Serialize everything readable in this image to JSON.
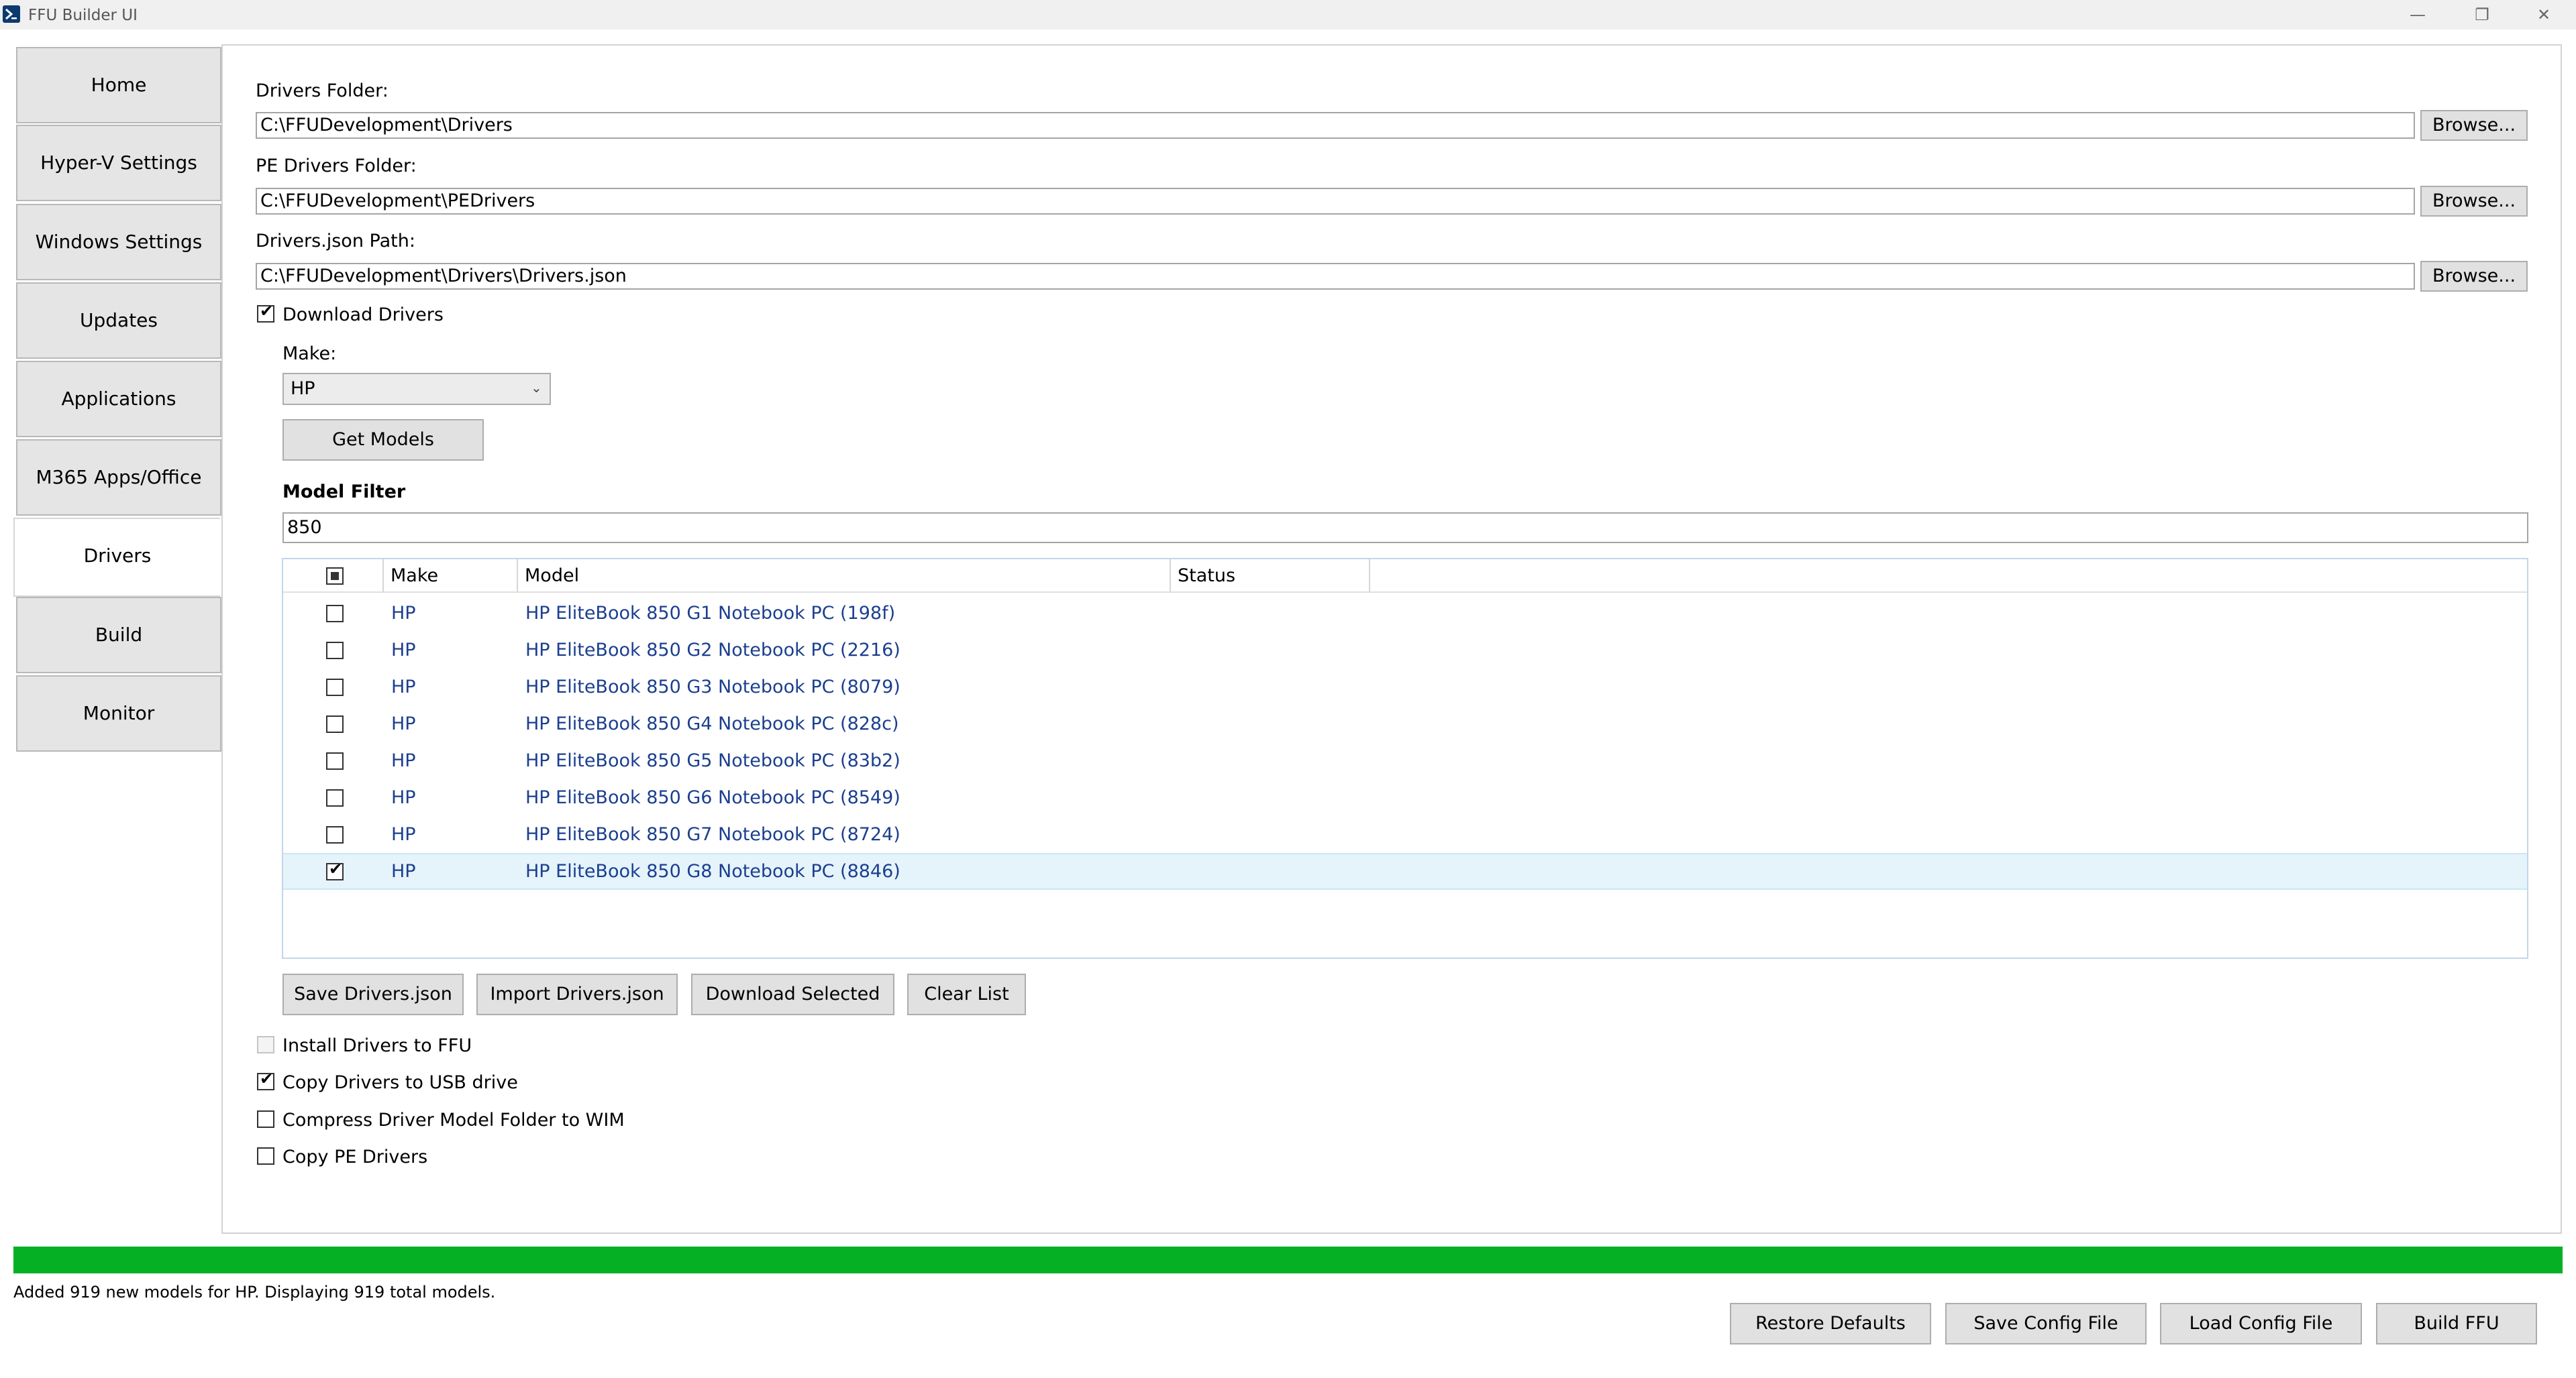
{
  "window": {
    "title": "FFU Builder UI",
    "minimize_glyph": "—",
    "restore_glyph": "❐",
    "close_glyph": "✕"
  },
  "nav": {
    "items": [
      {
        "label": "Home"
      },
      {
        "label": "Hyper-V Settings"
      },
      {
        "label": "Windows Settings"
      },
      {
        "label": "Updates"
      },
      {
        "label": "Applications"
      },
      {
        "label": "M365 Apps/Office"
      },
      {
        "label": "Drivers"
      },
      {
        "label": "Build"
      },
      {
        "label": "Monitor"
      }
    ],
    "active": "Drivers"
  },
  "drivers": {
    "drivers_folder_label": "Drivers Folder:",
    "drivers_folder_value": "C:\\FFUDevelopment\\Drivers",
    "pe_drivers_folder_label": "PE Drivers Folder:",
    "pe_drivers_folder_value": "C:\\FFUDevelopment\\PEDrivers",
    "drivers_json_label": "Drivers.json Path:",
    "drivers_json_value": "C:\\FFUDevelopment\\Drivers\\Drivers.json",
    "browse_label": "Browse...",
    "download_drivers_label": "Download Drivers",
    "download_drivers_checked": true,
    "make_label": "Make:",
    "make_selected": "HP",
    "get_models_label": "Get Models",
    "model_filter_label": "Model Filter",
    "model_filter_value": "850",
    "grid": {
      "columns": [
        "Make",
        "Model",
        "Status"
      ],
      "rows": [
        {
          "make": "HP",
          "model": "HP EliteBook 850 G1 Notebook PC (198f)",
          "status": "",
          "checked": false
        },
        {
          "make": "HP",
          "model": "HP EliteBook 850 G2 Notebook PC (2216)",
          "status": "",
          "checked": false
        },
        {
          "make": "HP",
          "model": "HP EliteBook 850 G3 Notebook PC (8079)",
          "status": "",
          "checked": false
        },
        {
          "make": "HP",
          "model": "HP EliteBook 850 G4 Notebook PC (828c)",
          "status": "",
          "checked": false
        },
        {
          "make": "HP",
          "model": "HP EliteBook 850 G5 Notebook PC (83b2)",
          "status": "",
          "checked": false
        },
        {
          "make": "HP",
          "model": "HP EliteBook 850 G6 Notebook PC (8549)",
          "status": "",
          "checked": false
        },
        {
          "make": "HP",
          "model": "HP EliteBook 850 G7 Notebook PC (8724)",
          "status": "",
          "checked": false
        },
        {
          "make": "HP",
          "model": "HP EliteBook 850 G8 Notebook PC (8846)",
          "status": "",
          "checked": true
        }
      ]
    },
    "save_drivers_json_label": "Save Drivers.json",
    "import_drivers_json_label": "Import Drivers.json",
    "download_selected_label": "Download Selected",
    "clear_list_label": "Clear List",
    "options": [
      {
        "label": "Install Drivers to FFU",
        "checked": false,
        "disabled": true
      },
      {
        "label": "Copy Drivers to USB drive",
        "checked": true,
        "disabled": false
      },
      {
        "label": "Compress Driver Model Folder to WIM",
        "checked": false,
        "disabled": false
      },
      {
        "label": "Copy PE Drivers",
        "checked": false,
        "disabled": false
      }
    ]
  },
  "progress": {
    "value": 1.0,
    "color": "#06b025"
  },
  "status_text": "Added 919 new models for HP. Displaying 919 total models.",
  "footer": {
    "restore_defaults": "Restore Defaults",
    "save_config": "Save Config File",
    "load_config": "Load Config File",
    "build_ffu": "Build FFU"
  }
}
